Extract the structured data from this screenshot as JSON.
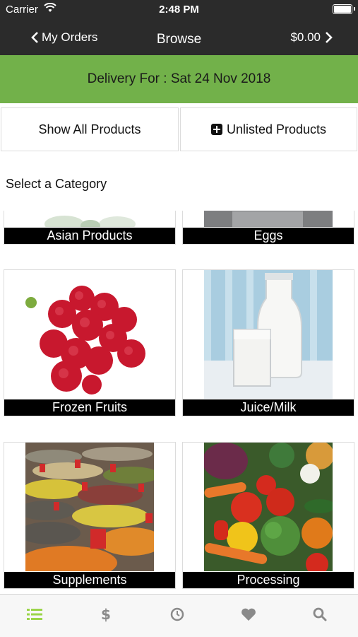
{
  "status_bar": {
    "carrier": "Carrier",
    "time": "2:48 PM"
  },
  "nav": {
    "back_label": "My Orders",
    "title": "Browse",
    "cart_total": "$0.00"
  },
  "delivery": {
    "text": "Delivery For : Sat 24 Nov 2018"
  },
  "buttons": {
    "show_all": "Show All Products",
    "unlisted": "Unlisted Products"
  },
  "section": {
    "title": "Select a Category"
  },
  "categories": [
    {
      "label": "Asian Products",
      "image": "asian-products-photo"
    },
    {
      "label": "Eggs",
      "image": "eggs-photo"
    },
    {
      "label": "Frozen Fruits",
      "image": "raspberries-photo"
    },
    {
      "label": "Juice/Milk",
      "image": "milk-photo"
    },
    {
      "label": "Supplements",
      "image": "grains-spices-photo"
    },
    {
      "label": "Processing",
      "image": "vegetables-photo"
    }
  ],
  "tabbar": {
    "items": [
      {
        "icon": "list-icon",
        "active": true
      },
      {
        "icon": "dollar-icon",
        "active": false
      },
      {
        "icon": "clock-icon",
        "active": false
      },
      {
        "icon": "heart-icon",
        "active": false
      },
      {
        "icon": "search-icon",
        "active": false
      }
    ]
  },
  "colors": {
    "nav_bg": "#2b2b2b",
    "accent_green": "#72b14a",
    "active_tab": "#9bd54a",
    "inactive_tab": "#8a8a8a"
  }
}
